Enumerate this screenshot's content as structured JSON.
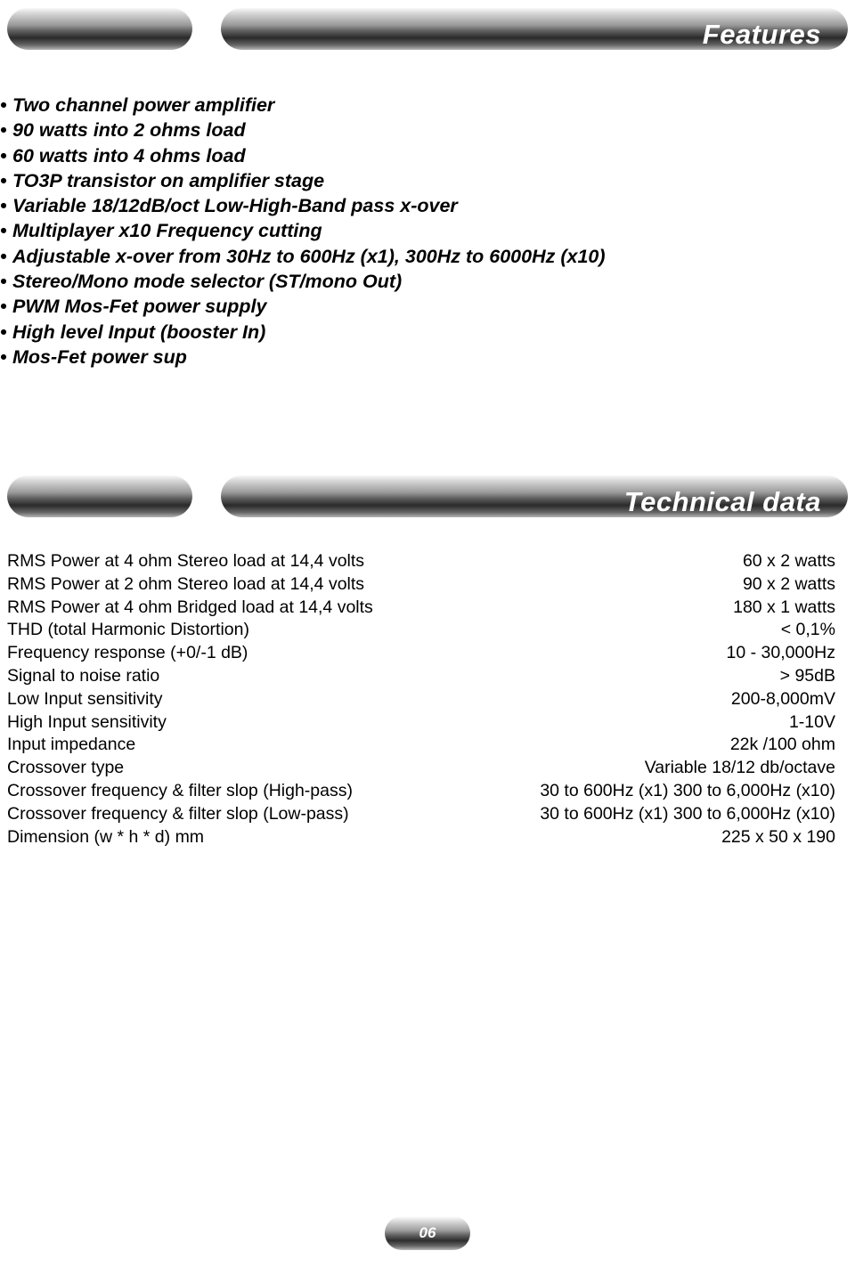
{
  "sections": {
    "features": {
      "banner_title": "Features",
      "items": [
        "Two channel power amplifier",
        "90 watts into 2 ohms load",
        "60 watts into 4 ohms load",
        "TO3P transistor on amplifier stage",
        "Variable 18/12dB/oct Low-High-Band pass x-over",
        "Multiplayer x10 Frequency cutting",
        "Adjustable x-over from 30Hz to 600Hz (x1), 300Hz to 6000Hz (x10)",
        "Stereo/Mono mode selector (ST/mono Out)",
        "PWM Mos-Fet power supply",
        "High level Input (booster In)",
        "Mos-Fet power sup"
      ]
    },
    "technical_data": {
      "banner_title": "Technical data",
      "rows": [
        {
          "label": "RMS Power at 4 ohm Stereo load at 14,4 volts",
          "value": "60 x 2 watts"
        },
        {
          "label": "RMS Power at 2 ohm Stereo load at 14,4 volts",
          "value": "90 x 2 watts"
        },
        {
          "label": "RMS Power at 4 ohm Bridged load at 14,4 volts",
          "value": "180 x 1 watts"
        },
        {
          "label": "THD (total Harmonic Distortion)",
          "value": "< 0,1%"
        },
        {
          "label": "Frequency response (+0/-1 dB)",
          "value": "10 - 30,000Hz"
        },
        {
          "label": "Signal to noise ratio",
          "value": "> 95dB"
        },
        {
          "label": "Low Input sensitivity",
          "value": "200-8,000mV"
        },
        {
          "label": "High Input sensitivity",
          "value": "1-10V"
        },
        {
          "label": "Input impedance",
          "value": "22k /100 ohm"
        },
        {
          "label": "Crossover type",
          "value": "Variable 18/12 db/octave"
        },
        {
          "label": "Crossover frequency & filter slop (High-pass)",
          "value": "30 to 600Hz (x1) 300 to 6,000Hz (x10)"
        },
        {
          "label": "Crossover frequency & filter slop (Low-pass)",
          "value": "30 to 600Hz (x1) 300 to 6,000Hz (x10)"
        },
        {
          "label": "Dimension (w * h * d) mm",
          "value": "225 x 50 x 190"
        }
      ]
    }
  },
  "footer": {
    "page_number": "06"
  }
}
